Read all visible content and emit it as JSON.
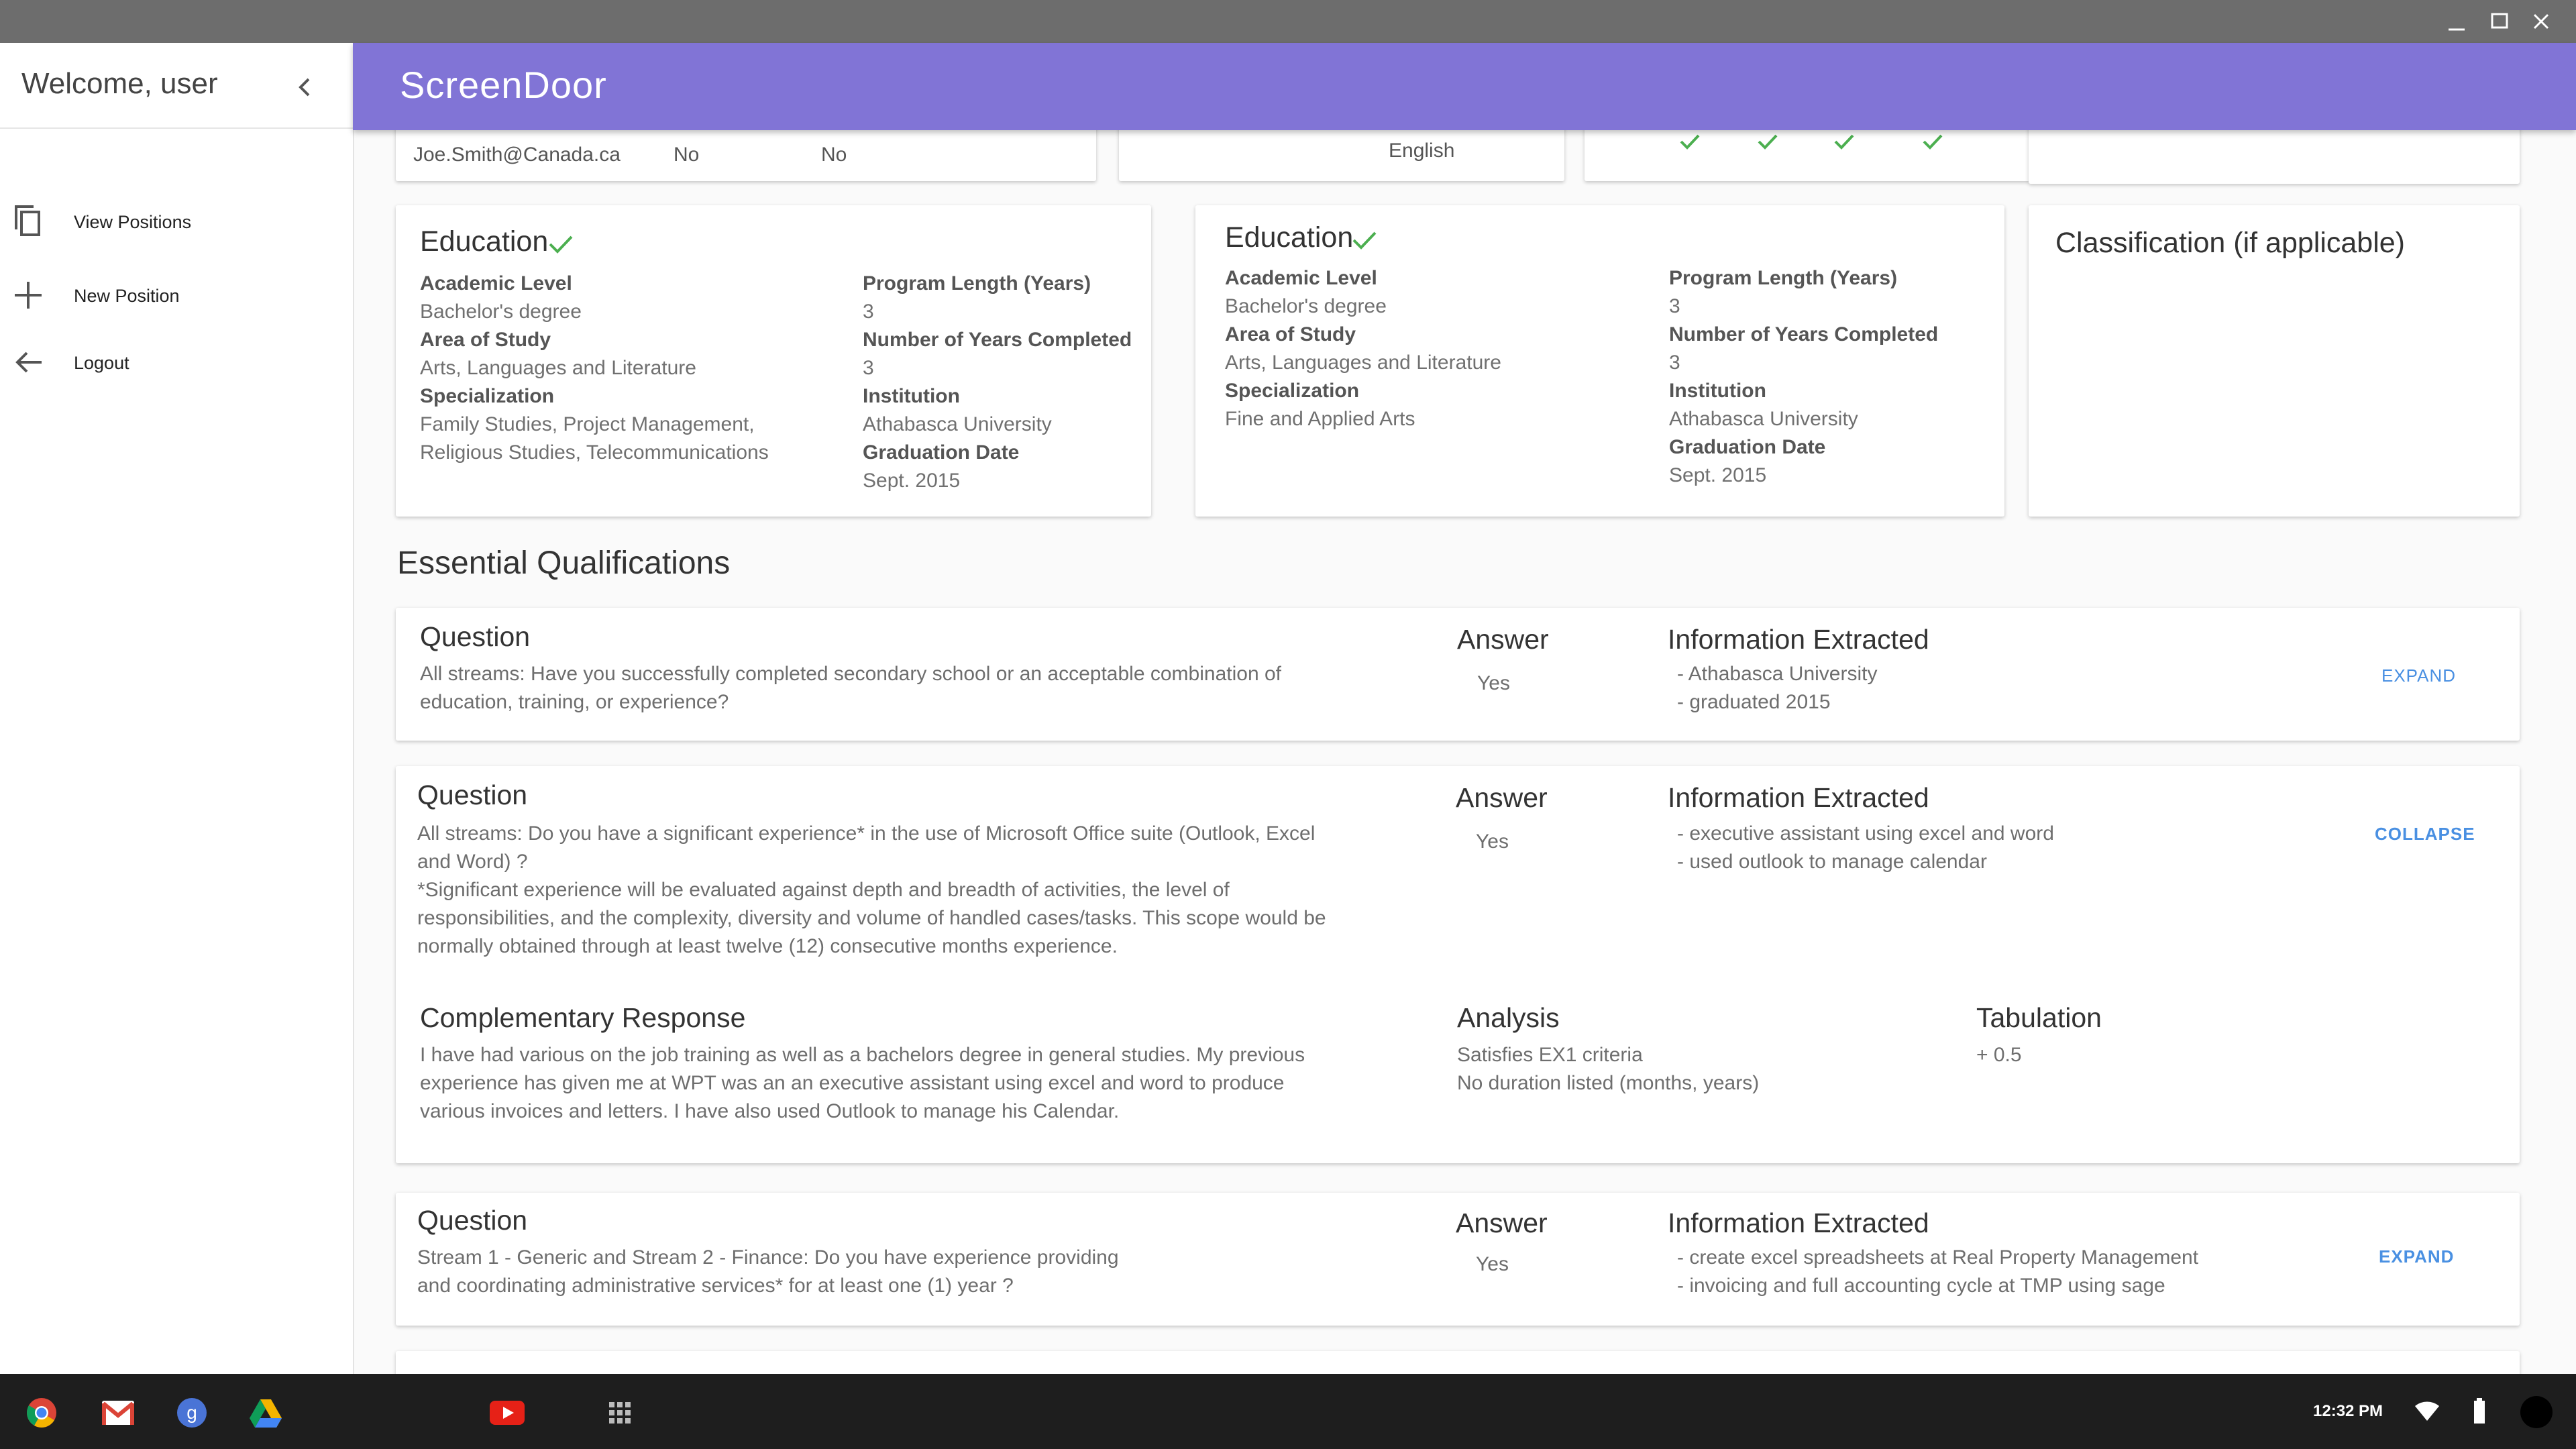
{
  "window": {
    "minimize_icon": "minimize-icon",
    "maximize_icon": "maximize-icon",
    "close_icon": "close-icon"
  },
  "sidebar": {
    "welcome": "Welcome, user",
    "items": [
      {
        "label": "View Positions",
        "icon": "copy-icon"
      },
      {
        "label": "New Position",
        "icon": "plus-icon"
      },
      {
        "label": "Logout",
        "icon": "arrow-left-icon"
      }
    ]
  },
  "header": {
    "logo": "ScreenDoor"
  },
  "top_cards": {
    "email": "Joe.Smith@Canada.ca",
    "col1": "No",
    "col2": "No",
    "language": "English"
  },
  "education_cards": [
    {
      "title": "Education",
      "academic_level_label": "Academic Level",
      "academic_level": "Bachelor's degree",
      "area_label": "Area of Study",
      "area": "Arts, Languages and Literature",
      "spec_label": "Specialization",
      "spec_line1": "Family Studies, Project Management,",
      "spec_line2": "Religious Studies, Telecommunications",
      "program_length_label": "Program Length (Years)",
      "program_length": "3",
      "years_completed_label": "Number of Years Completed",
      "years_completed": "3",
      "institution_label": "Institution",
      "institution": "Athabasca University",
      "graduation_label": "Graduation Date",
      "graduation": "Sept. 2015"
    },
    {
      "title": "Education",
      "academic_level_label": "Academic Level",
      "academic_level": "Bachelor's degree",
      "area_label": "Area of Study",
      "area": "Arts, Languages and Literature",
      "spec_label": "Specialization",
      "spec_line1": "Fine and Applied Arts",
      "program_length_label": "Program Length (Years)",
      "program_length": "3",
      "years_completed_label": "Number of Years Completed",
      "years_completed": "3",
      "institution_label": "Institution",
      "institution": "Athabasca University",
      "graduation_label": "Graduation Date",
      "graduation": "Sept. 2015"
    }
  ],
  "classification": {
    "title": "Classification (if applicable)"
  },
  "essential": {
    "title": "Essential Qualifications",
    "question_label": "Question",
    "answer_label": "Answer",
    "info_label": "Information Extracted",
    "questions": [
      {
        "q_line1": "All streams: Have you successfully completed secondary school or an acceptable combination of",
        "q_line2": "education, training, or experience?",
        "answer": "Yes",
        "info1": "- Athabasca University",
        "info2": "- graduated 2015",
        "toggle": "EXPAND"
      },
      {
        "q_line1": "All streams: Do you have a significant experience* in the use of Microsoft Office suite (Outlook, Excel",
        "q_line2": "and Word) ?",
        "q_line3": "*Significant experience will be evaluated against depth and breadth of activities, the level of",
        "q_line4": "responsibilities, and the complexity, diversity and volume of handled cases/tasks. This scope would be",
        "q_line5": "normally obtained through at least twelve (12) consecutive months experience.",
        "answer": "Yes",
        "info1": "- executive assistant using excel and word",
        "info2": "- used outlook to manage calendar",
        "toggle": "COLLAPSE",
        "complementary_label": "Complementary Response",
        "comp_line1": "I have had various on the job training as well as a bachelors degree in general studies. My previous",
        "comp_line2": "experience has given me at WPT was an an executive assistant using excel and word to produce",
        "comp_line3": "various invoices and letters. I have also used Outlook to manage his Calendar.",
        "analysis_label": "Analysis",
        "analysis1": "Satisfies EX1 criteria",
        "analysis2": "No duration listed (months, years)",
        "tabulation_label": "Tabulation",
        "tabulation": "+ 0.5"
      },
      {
        "q_line1": "Stream 1 - Generic and Stream 2 - Finance: Do you have experience providing",
        "q_line2": "and coordinating administrative services* for at least one (1) year ?",
        "answer": "Yes",
        "info1": "- create excel spreadsheets at Real Property Management",
        "info2": "- invoicing and full accounting cycle at TMP using sage",
        "toggle": "EXPAND"
      }
    ]
  },
  "taskbar": {
    "apps": [
      "chrome-icon",
      "gmail-icon",
      "google-search-icon",
      "drive-icon",
      "youtube-icon",
      "app-launcher-icon"
    ],
    "time": "12:32 PM"
  },
  "colors": {
    "header": "#8174d6",
    "link": "#4a90e2",
    "check": "#4caf50"
  }
}
